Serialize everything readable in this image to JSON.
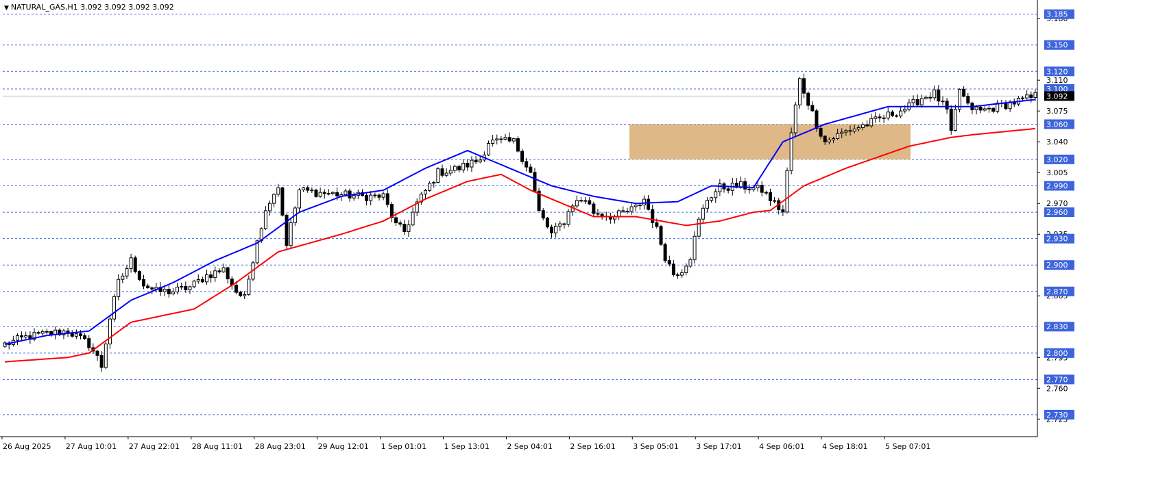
{
  "header": {
    "symbol": "NATURAL_GAS",
    "timeframe": "H1",
    "ohlc": "3.092 3.092 3.092 3.092",
    "title": "NATURAL_GAS,H1  3.092 3.092 3.092 3.092"
  },
  "chart_data": {
    "type": "candlestick",
    "title": "NATURAL_GAS,H1  3.092 3.092 3.092 3.092",
    "ylim": [
      2.705,
      3.198
    ],
    "current_price": "3.092",
    "price_axis_ticks": [
      "3.180",
      "3.110",
      "3.075",
      "3.040",
      "3.005",
      "2.970",
      "2.935",
      "2.865",
      "2.795",
      "2.760",
      "2.725"
    ],
    "level_lines": [
      "3.185",
      "3.150",
      "3.120",
      "3.100",
      "3.060",
      "3.020",
      "2.990",
      "2.960",
      "2.930",
      "2.900",
      "2.870",
      "2.830",
      "2.800",
      "2.770",
      "2.730"
    ],
    "time_labels": [
      "26 Aug 2025",
      "27 Aug 10:01",
      "27 Aug 22:01",
      "28 Aug 11:01",
      "28 Aug 23:01",
      "29 Aug 12:01",
      "1 Sep 01:01",
      "1 Sep 13:01",
      "2 Sep 04:01",
      "2 Sep 16:01",
      "3 Sep 05:01",
      "3 Sep 17:01",
      "4 Sep 06:01",
      "4 Sep 18:01",
      "5 Sep 07:01"
    ],
    "zone": {
      "low": 3.02,
      "high": 3.06,
      "color": "#deb887"
    },
    "ma_fast": {
      "color": "#0000ff",
      "anchors": [
        [
          0,
          2.81
        ],
        [
          10,
          2.82
        ],
        [
          20,
          2.825
        ],
        [
          30,
          2.86
        ],
        [
          40,
          2.88
        ],
        [
          50,
          2.905
        ],
        [
          60,
          2.925
        ],
        [
          70,
          2.96
        ],
        [
          80,
          2.978
        ],
        [
          90,
          2.985
        ],
        [
          100,
          3.01
        ],
        [
          110,
          3.03
        ],
        [
          120,
          3.01
        ],
        [
          130,
          2.99
        ],
        [
          140,
          2.978
        ],
        [
          150,
          2.97
        ],
        [
          160,
          2.972
        ],
        [
          168,
          2.99
        ],
        [
          178,
          2.988
        ],
        [
          185,
          3.04
        ],
        [
          195,
          3.06
        ],
        [
          210,
          3.08
        ],
        [
          230,
          3.08
        ],
        [
          245,
          3.088
        ]
      ]
    },
    "ma_slow": {
      "color": "#ff0000",
      "anchors": [
        [
          0,
          2.79
        ],
        [
          15,
          2.795
        ],
        [
          20,
          2.8
        ],
        [
          30,
          2.835
        ],
        [
          45,
          2.85
        ],
        [
          55,
          2.88
        ],
        [
          65,
          2.915
        ],
        [
          80,
          2.935
        ],
        [
          90,
          2.95
        ],
        [
          100,
          2.975
        ],
        [
          110,
          2.995
        ],
        [
          118,
          3.003
        ],
        [
          125,
          2.985
        ],
        [
          140,
          2.955
        ],
        [
          150,
          2.955
        ],
        [
          162,
          2.945
        ],
        [
          170,
          2.95
        ],
        [
          178,
          2.96
        ],
        [
          182,
          2.962
        ],
        [
          190,
          2.99
        ],
        [
          200,
          3.01
        ],
        [
          215,
          3.035
        ],
        [
          225,
          3.045
        ],
        [
          230,
          3.048
        ],
        [
          245,
          3.055
        ]
      ]
    },
    "price_anchors": [
      [
        0,
        2.81
      ],
      [
        5,
        2.818
      ],
      [
        10,
        2.822
      ],
      [
        15,
        2.825
      ],
      [
        20,
        2.81
      ],
      [
        22,
        2.795
      ],
      [
        23,
        2.785
      ],
      [
        25,
        2.84
      ],
      [
        27,
        2.88
      ],
      [
        30,
        2.905
      ],
      [
        33,
        2.878
      ],
      [
        36,
        2.87
      ],
      [
        40,
        2.87
      ],
      [
        44,
        2.875
      ],
      [
        48,
        2.888
      ],
      [
        52,
        2.895
      ],
      [
        55,
        2.87
      ],
      [
        57,
        2.862
      ],
      [
        60,
        2.93
      ],
      [
        63,
        2.975
      ],
      [
        65,
        2.99
      ],
      [
        67,
        2.925
      ],
      [
        70,
        2.985
      ],
      [
        75,
        2.982
      ],
      [
        80,
        2.98
      ],
      [
        85,
        2.978
      ],
      [
        90,
        2.978
      ],
      [
        93,
        2.945
      ],
      [
        95,
        2.938
      ],
      [
        98,
        2.97
      ],
      [
        103,
        3.005
      ],
      [
        108,
        3.01
      ],
      [
        113,
        3.02
      ],
      [
        115,
        3.04
      ],
      [
        118,
        3.04
      ],
      [
        121,
        3.04
      ],
      [
        125,
        3.005
      ],
      [
        127,
        2.96
      ],
      [
        130,
        2.935
      ],
      [
        133,
        2.95
      ],
      [
        135,
        2.97
      ],
      [
        138,
        2.975
      ],
      [
        140,
        2.96
      ],
      [
        145,
        2.955
      ],
      [
        150,
        2.965
      ],
      [
        152,
        2.975
      ],
      [
        155,
        2.94
      ],
      [
        157,
        2.91
      ],
      [
        159,
        2.89
      ],
      [
        161,
        2.895
      ],
      [
        163,
        2.91
      ],
      [
        165,
        2.95
      ],
      [
        167,
        2.975
      ],
      [
        170,
        2.988
      ],
      [
        175,
        2.99
      ],
      [
        180,
        2.985
      ],
      [
        182,
        2.975
      ],
      [
        185,
        2.96
      ],
      [
        187,
        3.05
      ],
      [
        189,
        3.11
      ],
      [
        191,
        3.085
      ],
      [
        193,
        3.06
      ],
      [
        195,
        3.04
      ],
      [
        197,
        3.045
      ],
      [
        200,
        3.052
      ],
      [
        205,
        3.06
      ],
      [
        210,
        3.07
      ],
      [
        215,
        3.08
      ],
      [
        218,
        3.09
      ],
      [
        221,
        3.095
      ],
      [
        224,
        3.075
      ],
      [
        225,
        3.048
      ],
      [
        227,
        3.1
      ],
      [
        229,
        3.08
      ],
      [
        232,
        3.075
      ],
      [
        236,
        3.08
      ],
      [
        240,
        3.085
      ],
      [
        244,
        3.09
      ],
      [
        245,
        3.092
      ]
    ]
  }
}
